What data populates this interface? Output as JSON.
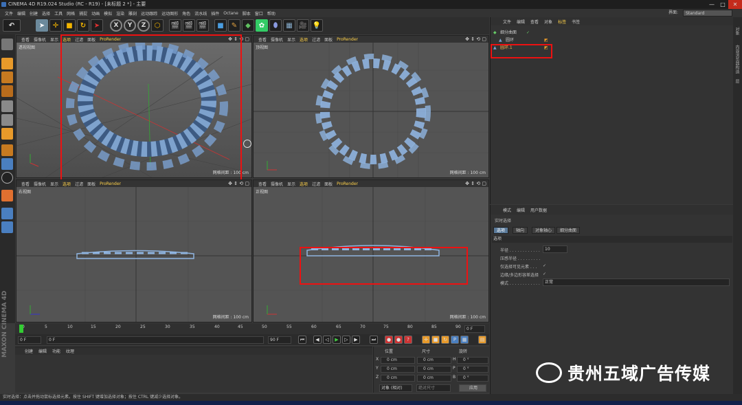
{
  "titlebar": {
    "title": "CINEMA 4D R19.024 Studio (RC - R19) - [未标题 2 *] - 主要"
  },
  "menu": [
    "文件",
    "编辑",
    "创建",
    "选择",
    "工具",
    "网格",
    "捕捉",
    "动画",
    "模拟",
    "渲染",
    "雕刻",
    "运动跟踪",
    "运动图形",
    "角色",
    "流水线",
    "插件",
    "Octane",
    "脚本",
    "窗口",
    "帮助"
  ],
  "layout": {
    "label": "界面:",
    "value": "Standard"
  },
  "toolbar": {
    "x": "X",
    "y": "Y",
    "z": "Z"
  },
  "viewports": [
    {
      "menu": [
        "查看",
        "摄像机",
        "显示",
        "选项",
        "过滤",
        "面板",
        "ProRender"
      ],
      "label": "透视视图",
      "grid": "网格间距 : 100 cm"
    },
    {
      "menu": [
        "查看",
        "摄像机",
        "显示",
        "选项",
        "过滤",
        "面板",
        "ProRender"
      ],
      "label": "顶视图",
      "grid": "网格间距 : 100 cm"
    },
    {
      "menu": [
        "查看",
        "摄像机",
        "显示",
        "选项",
        "过滤",
        "面板",
        "ProRender"
      ],
      "label": "右视图",
      "grid": "网格间距 : 100 cm"
    },
    {
      "menu": [
        "查看",
        "摄像机",
        "显示",
        "选项",
        "过滤",
        "面板",
        "ProRender"
      ],
      "label": "正视图",
      "grid": "网格间距 : 100 cm"
    }
  ],
  "timeline": {
    "ticks": [
      "0",
      "5",
      "10",
      "15",
      "20",
      "25",
      "30",
      "35",
      "40",
      "45",
      "50",
      "55",
      "60",
      "65",
      "70",
      "75",
      "80",
      "85",
      "90"
    ],
    "current_frame": "0 F"
  },
  "transport": {
    "start": "0 F",
    "start2": "0 F",
    "end": "90 F",
    "end2": "90 F"
  },
  "material_menu": [
    "创建",
    "编辑",
    "功能",
    "纹理"
  ],
  "coords": {
    "headers": [
      "位置",
      "尺寸",
      "旋转"
    ],
    "rows": [
      {
        "axis": "X",
        "pos": "0 cm",
        "size": "0 cm",
        "rax": "H",
        "rot": "0 °"
      },
      {
        "axis": "Y",
        "pos": "0 cm",
        "size": "0 cm",
        "rax": "P",
        "rot": "0 °"
      },
      {
        "axis": "Z",
        "pos": "0 cm",
        "size": "0 cm",
        "rax": "B",
        "rot": "0 °"
      }
    ],
    "mode": "对象 (相对)",
    "size_mode": "绝对尺寸",
    "apply": "应用"
  },
  "status": "实时选择：点击并拖动鼠标选择元素。按住 SHIFT 键增加选择对象；按住 CTRL 键减少选择对象。",
  "objmgr": {
    "menu": [
      "文件",
      "编辑",
      "查看",
      "对象",
      "标签",
      "书签"
    ],
    "objects": [
      "细分曲面",
      "圆环",
      "圆环.1"
    ]
  },
  "attrmgr": {
    "menu": [
      "模式",
      "编辑",
      "用户数据"
    ],
    "title": "实时选择",
    "tabs": [
      "选项",
      "轴向",
      "对象轴心",
      "细分曲面"
    ],
    "section": "选项",
    "rows": [
      {
        "label": "半径 . . . . . . . . . . . .",
        "value": "10"
      },
      {
        "label": "压感半径 . . . . . . . . .",
        "value": ""
      },
      {
        "label": "仅选择可见元素 . . .",
        "value": "✓"
      },
      {
        "label": "边缘/多边形容差选择",
        "value": "✓"
      },
      {
        "label": "模式 . . . . . . . . . . . .",
        "value": "正常"
      }
    ]
  },
  "rightstrip": [
    "对象",
    "内容浏览器",
    "构造",
    "层"
  ],
  "watermark": "贵州五域广告传媒"
}
